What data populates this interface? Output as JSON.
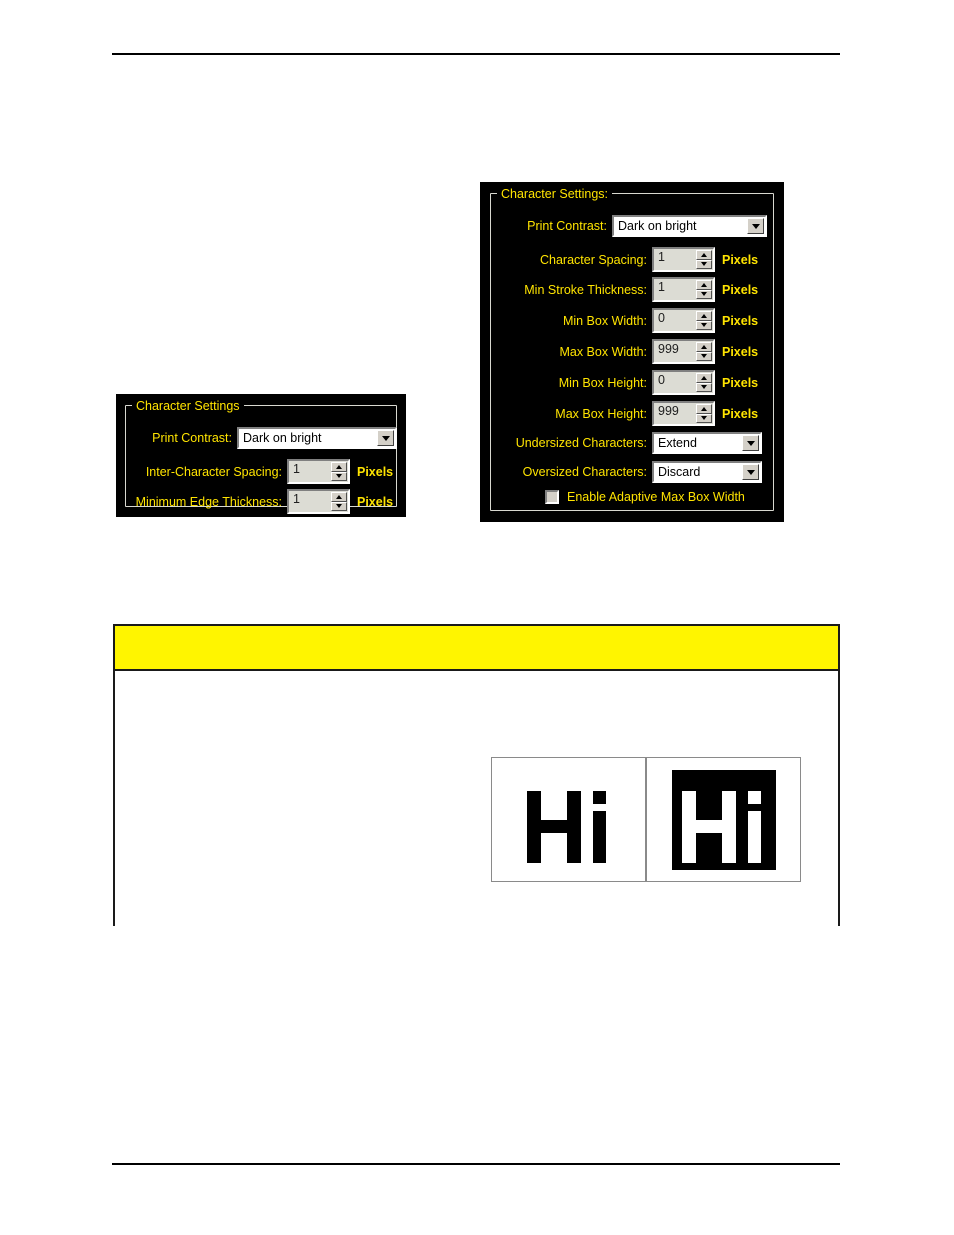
{
  "page": {
    "header_rule": true,
    "footer_rule": true
  },
  "dialog_left": {
    "group_label": "Character Settings",
    "fields": [
      {
        "label": "Print Contrast:",
        "control": "combo",
        "value": "Dark on bright",
        "unit": "",
        "icon": "chevron-down-icon"
      },
      {
        "label": "Inter-Character Spacing:",
        "control": "spinner",
        "value": "1",
        "unit": "Pixels",
        "icon": "spinner-arrows-icon"
      },
      {
        "label": "Minimum Edge Thickness:",
        "control": "spinner",
        "value": "1",
        "unit": "Pixels",
        "icon": "spinner-arrows-icon"
      }
    ]
  },
  "dialog_right": {
    "group_label": "Character Settings:",
    "fields": [
      {
        "label": "Print Contrast:",
        "control": "combo",
        "value": "Dark on bright",
        "unit": "",
        "icon": "chevron-down-icon"
      },
      {
        "label": "Character Spacing:",
        "control": "spinner",
        "value": "1",
        "unit": "Pixels",
        "icon": "spinner-arrows-icon"
      },
      {
        "label": "Min Stroke Thickness:",
        "control": "spinner",
        "value": "1",
        "unit": "Pixels",
        "icon": "spinner-arrows-icon"
      },
      {
        "label": "Min Box Width:",
        "control": "spinner",
        "value": "0",
        "unit": "Pixels",
        "icon": "spinner-arrows-icon"
      },
      {
        "label": "Max Box Width:",
        "control": "spinner",
        "value": "999",
        "unit": "Pixels",
        "icon": "spinner-arrows-icon"
      },
      {
        "label": "Min Box Height:",
        "control": "spinner",
        "value": "0",
        "unit": "Pixels",
        "icon": "spinner-arrows-icon"
      },
      {
        "label": "Max Box Height:",
        "control": "spinner",
        "value": "999",
        "unit": "Pixels",
        "icon": "spinner-arrows-icon"
      },
      {
        "label": "Undersized Characters:",
        "control": "combo",
        "value": "Extend",
        "unit": "",
        "icon": "chevron-down-icon"
      },
      {
        "label": "Oversized Characters:",
        "control": "combo",
        "value": "Discard",
        "unit": "",
        "icon": "chevron-down-icon"
      }
    ],
    "checkbox": {
      "label": "Enable Adaptive Max Box Width",
      "checked": false
    }
  },
  "content_table": {
    "banner_text": "",
    "banner_color": "#fff500",
    "image_cells": [
      {
        "caption": "",
        "alt": "Hi rendered dark characters on bright background"
      },
      {
        "caption": "",
        "alt": "Hi rendered bright characters on dark background"
      }
    ]
  },
  "colors": {
    "dialog_background": "#000000",
    "label_text": "#ffe400",
    "field_background": "#ffffff",
    "spinner_background": "#dcdcd4",
    "button_face": "#d4d0c8",
    "banner_yellow": "#fff500",
    "table_border": "#1a1a1a"
  }
}
